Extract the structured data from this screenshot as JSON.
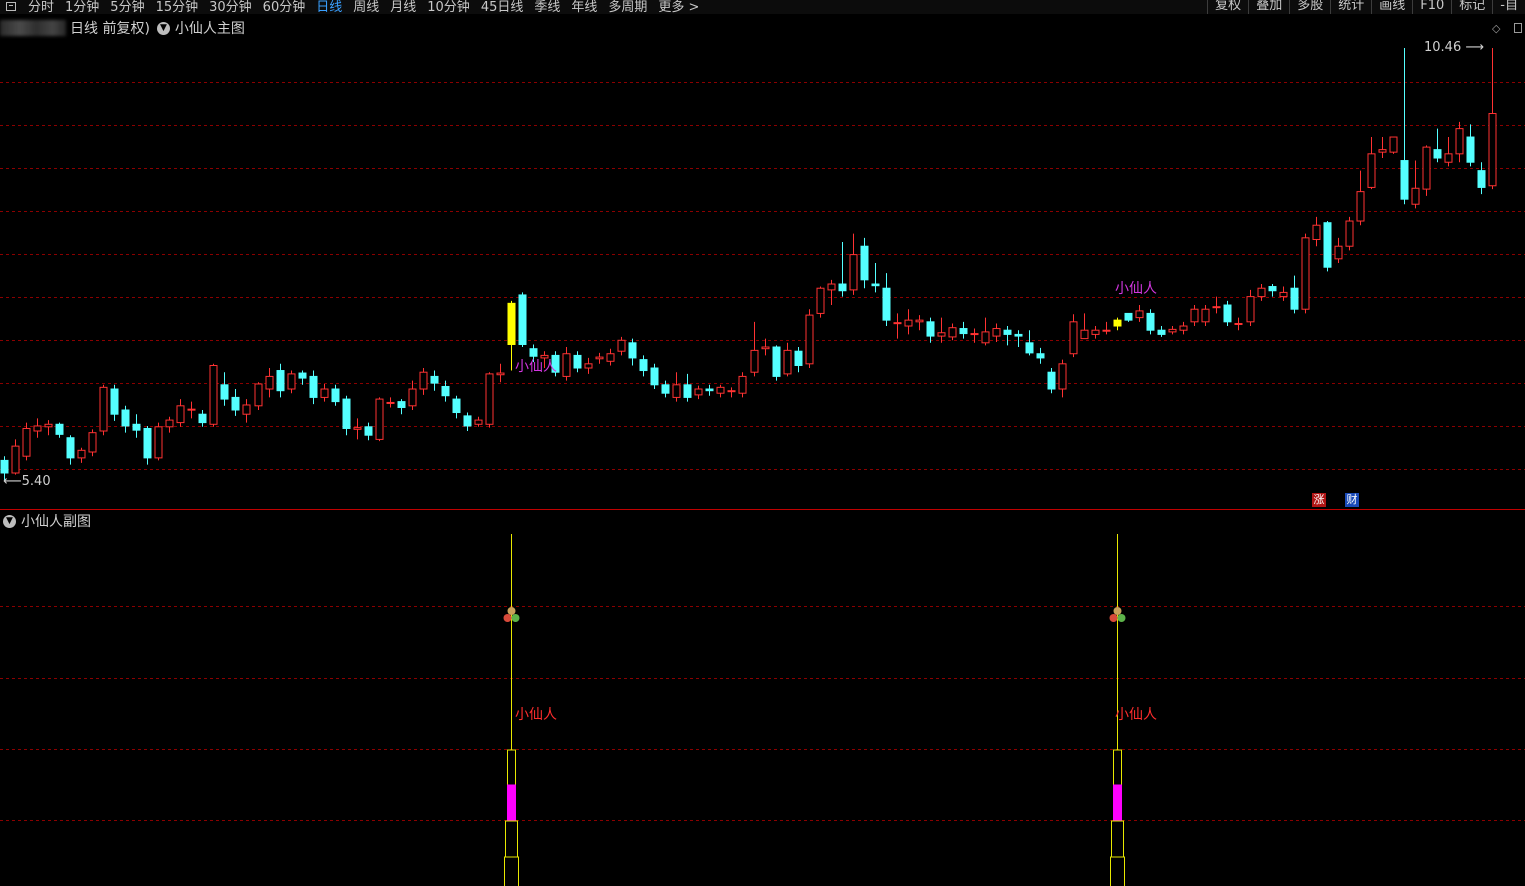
{
  "toolbar": {
    "periods": [
      "分时",
      "1分钟",
      "5分钟",
      "15分钟",
      "30分钟",
      "60分钟",
      "日线",
      "周线",
      "月线",
      "10分钟",
      "45日线",
      "季线",
      "年线",
      "多周期",
      "更多 >"
    ],
    "active_period": "日线",
    "tools": [
      "复权",
      "叠加",
      "多股",
      "统计",
      "画线",
      "F10",
      "标记",
      "-自"
    ]
  },
  "main_panel": {
    "title_prefix": "日线 前复权)",
    "indicator_name": "小仙人主图",
    "high_label": "10.46",
    "low_label": "5.40",
    "signal_label": "小仙人"
  },
  "badges": {
    "zhang": "涨",
    "cai": "财"
  },
  "sub_panel": {
    "title": "小仙人副图",
    "signal_label": "小仙人"
  },
  "colors": {
    "up": "#ff3232",
    "down": "#54ffff",
    "signal_candle": "#ffff00",
    "main_signal_text": "#d236e0",
    "sub_signal_text": "#ff2d2d",
    "signal_line": "#e8e800",
    "signal_bar_fill": "#ff00ff",
    "grid": "#8b0000",
    "panel_divider": "#c00000"
  },
  "chart_data": {
    "type": "candlestick",
    "price_high": 10.46,
    "price_low": 5.4,
    "candles": [
      [
        5.55,
        5.4,
        5.3,
        5.6
      ],
      [
        5.4,
        5.72,
        5.38,
        5.8
      ],
      [
        5.6,
        5.93,
        5.55,
        6.0
      ],
      [
        5.9,
        5.96,
        5.82,
        6.05
      ],
      [
        5.95,
        5.98,
        5.85,
        6.03
      ],
      [
        5.98,
        5.86,
        5.82,
        6.0
      ],
      [
        5.82,
        5.58,
        5.5,
        5.85
      ],
      [
        5.58,
        5.67,
        5.52,
        5.7
      ],
      [
        5.65,
        5.88,
        5.6,
        5.92
      ],
      [
        5.9,
        6.42,
        5.85,
        6.45
      ],
      [
        6.4,
        6.1,
        6.02,
        6.45
      ],
      [
        6.15,
        5.96,
        5.88,
        6.2
      ],
      [
        5.98,
        5.91,
        5.82,
        6.1
      ],
      [
        5.93,
        5.58,
        5.5,
        5.96
      ],
      [
        5.58,
        5.95,
        5.55,
        6.0
      ],
      [
        5.95,
        6.03,
        5.88,
        6.07
      ],
      [
        6.0,
        6.2,
        5.95,
        6.28
      ],
      [
        6.15,
        6.16,
        6.05,
        6.25
      ],
      [
        6.1,
        6.0,
        5.95,
        6.15
      ],
      [
        5.98,
        6.68,
        5.95,
        6.7
      ],
      [
        6.45,
        6.28,
        6.2,
        6.6
      ],
      [
        6.3,
        6.15,
        6.08,
        6.4
      ],
      [
        6.1,
        6.21,
        6.0,
        6.28
      ],
      [
        6.2,
        6.46,
        6.15,
        6.48
      ],
      [
        6.4,
        6.55,
        6.3,
        6.65
      ],
      [
        6.62,
        6.38,
        6.3,
        6.7
      ],
      [
        6.4,
        6.58,
        6.35,
        6.62
      ],
      [
        6.59,
        6.53,
        6.45,
        6.62
      ],
      [
        6.55,
        6.3,
        6.22,
        6.62
      ],
      [
        6.3,
        6.4,
        6.25,
        6.46
      ],
      [
        6.4,
        6.25,
        6.2,
        6.45
      ],
      [
        6.28,
        5.93,
        5.85,
        6.32
      ],
      [
        5.92,
        5.94,
        5.8,
        6.05
      ],
      [
        5.95,
        5.85,
        5.79,
        6.0
      ],
      [
        5.8,
        6.28,
        5.78,
        6.3
      ],
      [
        6.23,
        6.24,
        6.18,
        6.3
      ],
      [
        6.25,
        6.18,
        6.1,
        6.28
      ],
      [
        6.2,
        6.4,
        6.15,
        6.5
      ],
      [
        6.4,
        6.6,
        6.33,
        6.65
      ],
      [
        6.55,
        6.47,
        6.38,
        6.62
      ],
      [
        6.43,
        6.32,
        6.25,
        6.5
      ],
      [
        6.28,
        6.12,
        6.05,
        6.32
      ],
      [
        6.08,
        5.96,
        5.9,
        6.12
      ],
      [
        5.98,
        6.03,
        5.95,
        6.07
      ],
      [
        5.98,
        6.58,
        5.94,
        6.6
      ],
      [
        6.57,
        6.59,
        6.48,
        6.7
      ],
      [
        6.93,
        7.42,
        6.62,
        7.45
      ],
      [
        7.52,
        6.93,
        6.9,
        7.55
      ],
      [
        6.88,
        6.79,
        6.72,
        6.93
      ],
      [
        6.77,
        6.8,
        6.65,
        6.85
      ],
      [
        6.8,
        6.6,
        6.55,
        6.85
      ],
      [
        6.55,
        6.82,
        6.5,
        6.9
      ],
      [
        6.8,
        6.65,
        6.6,
        6.85
      ],
      [
        6.65,
        6.7,
        6.58,
        6.77
      ],
      [
        6.76,
        6.78,
        6.7,
        6.83
      ],
      [
        6.73,
        6.82,
        6.68,
        6.88
      ],
      [
        6.85,
        6.98,
        6.8,
        7.02
      ],
      [
        6.95,
        6.77,
        6.68,
        7.0
      ],
      [
        6.75,
        6.62,
        6.55,
        6.8
      ],
      [
        6.65,
        6.45,
        6.4,
        6.7
      ],
      [
        6.45,
        6.35,
        6.3,
        6.5
      ],
      [
        6.3,
        6.45,
        6.25,
        6.6
      ],
      [
        6.45,
        6.3,
        6.25,
        6.58
      ],
      [
        6.33,
        6.4,
        6.28,
        6.44
      ],
      [
        6.4,
        6.38,
        6.32,
        6.45
      ],
      [
        6.35,
        6.42,
        6.3,
        6.45
      ],
      [
        6.38,
        6.38,
        6.3,
        6.42
      ],
      [
        6.35,
        6.55,
        6.3,
        6.6
      ],
      [
        6.6,
        6.86,
        6.55,
        7.2
      ],
      [
        6.88,
        6.9,
        6.8,
        7.0
      ],
      [
        6.9,
        6.55,
        6.5,
        6.92
      ],
      [
        6.58,
        6.86,
        6.55,
        6.95
      ],
      [
        6.85,
        6.68,
        6.6,
        6.9
      ],
      [
        6.7,
        7.28,
        6.65,
        7.35
      ],
      [
        7.3,
        7.6,
        7.25,
        7.62
      ],
      [
        7.58,
        7.65,
        7.4,
        7.7
      ],
      [
        7.65,
        7.57,
        7.5,
        8.15
      ],
      [
        7.58,
        8.0,
        7.52,
        8.25
      ],
      [
        8.1,
        7.7,
        7.6,
        8.2
      ],
      [
        7.65,
        7.63,
        7.55,
        7.9
      ],
      [
        7.6,
        7.22,
        7.15,
        7.78
      ],
      [
        7.18,
        7.19,
        7.0,
        7.3
      ],
      [
        7.15,
        7.22,
        7.05,
        7.35
      ],
      [
        7.2,
        7.22,
        7.1,
        7.28
      ],
      [
        7.2,
        7.03,
        6.95,
        7.25
      ],
      [
        7.03,
        7.07,
        6.95,
        7.25
      ],
      [
        7.02,
        7.13,
        6.98,
        7.18
      ],
      [
        7.12,
        7.06,
        7.0,
        7.2
      ],
      [
        7.05,
        7.06,
        6.95,
        7.12
      ],
      [
        6.95,
        7.08,
        6.92,
        7.25
      ],
      [
        7.03,
        7.12,
        6.96,
        7.18
      ],
      [
        7.1,
        7.05,
        6.92,
        7.15
      ],
      [
        7.05,
        7.03,
        6.9,
        7.1
      ],
      [
        6.95,
        6.83,
        6.8,
        7.1
      ],
      [
        6.82,
        6.77,
        6.7,
        6.89
      ],
      [
        6.6,
        6.4,
        6.35,
        6.65
      ],
      [
        6.4,
        6.7,
        6.3,
        6.75
      ],
      [
        6.82,
        7.2,
        6.78,
        7.29
      ],
      [
        7.0,
        7.1,
        7.0,
        7.3
      ],
      [
        7.05,
        7.1,
        7.0,
        7.15
      ],
      [
        7.1,
        7.1,
        7.05,
        7.2
      ],
      [
        7.15,
        7.22,
        7.1,
        7.25
      ],
      [
        7.3,
        7.22,
        7.2,
        7.3
      ],
      [
        7.25,
        7.33,
        7.2,
        7.4
      ],
      [
        7.3,
        7.1,
        7.05,
        7.35
      ],
      [
        7.1,
        7.05,
        7.02,
        7.15
      ],
      [
        7.08,
        7.11,
        7.05,
        7.15
      ],
      [
        7.1,
        7.15,
        7.05,
        7.2
      ],
      [
        7.2,
        7.35,
        7.15,
        7.4
      ],
      [
        7.2,
        7.35,
        7.15,
        7.4
      ],
      [
        7.38,
        7.38,
        7.3,
        7.5
      ],
      [
        7.4,
        7.2,
        7.15,
        7.45
      ],
      [
        7.18,
        7.18,
        7.1,
        7.25
      ],
      [
        7.2,
        7.5,
        7.15,
        7.58
      ],
      [
        7.5,
        7.6,
        7.45,
        7.65
      ],
      [
        7.62,
        7.57,
        7.5,
        7.65
      ],
      [
        7.5,
        7.55,
        7.45,
        7.62
      ],
      [
        7.6,
        7.35,
        7.3,
        7.75
      ],
      [
        7.35,
        8.2,
        7.3,
        8.25
      ],
      [
        8.18,
        8.35,
        8.1,
        8.45
      ],
      [
        8.38,
        7.85,
        7.8,
        8.4
      ],
      [
        7.95,
        8.1,
        7.9,
        8.2
      ],
      [
        8.1,
        8.4,
        8.05,
        8.45
      ],
      [
        8.4,
        8.75,
        8.35,
        9.0
      ],
      [
        8.8,
        9.2,
        8.78,
        9.4
      ],
      [
        9.22,
        9.25,
        9.15,
        9.4
      ],
      [
        9.22,
        9.4,
        9.2,
        9.4
      ],
      [
        9.12,
        8.66,
        8.6,
        10.46
      ],
      [
        8.6,
        8.79,
        8.55,
        9.12
      ],
      [
        8.78,
        9.28,
        8.7,
        9.3
      ],
      [
        9.25,
        9.15,
        9.1,
        9.5
      ],
      [
        9.1,
        9.2,
        9.05,
        9.4
      ],
      [
        9.2,
        9.5,
        9.1,
        9.58
      ],
      [
        9.4,
        9.1,
        9.05,
        9.55
      ],
      [
        9.0,
        8.8,
        8.72,
        9.1
      ],
      [
        8.82,
        9.68,
        8.78,
        10.46
      ]
    ],
    "signals": [
      {
        "candle_index": 46,
        "label": "小仙人"
      },
      {
        "candle_index": 101,
        "label": "小仙人"
      }
    ]
  }
}
